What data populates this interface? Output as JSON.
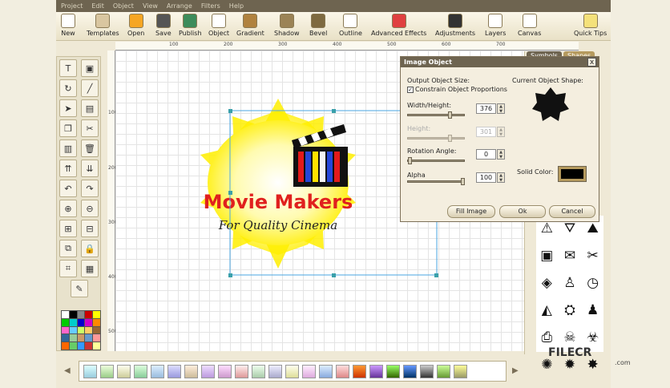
{
  "menu": [
    "Project",
    "Edit",
    "Object",
    "View",
    "Arrange",
    "Filters",
    "Help"
  ],
  "toolbar": [
    {
      "label": "New",
      "icon": "new-page-icon",
      "color": "#ffffff"
    },
    {
      "label": "Templates",
      "icon": "templates-icon",
      "color": "#d9c6a0"
    },
    {
      "label": "Open",
      "icon": "open-icon",
      "color": "#f6a623"
    },
    {
      "label": "Save",
      "icon": "save-icon",
      "color": "#555555"
    },
    {
      "label": "Publish",
      "icon": "globe-icon",
      "color": "#3d8c5b"
    },
    {
      "label": "Object",
      "icon": "object-icon",
      "color": "#ffffff"
    },
    {
      "label": "Gradient",
      "icon": "gradient-icon",
      "color": "#b0823f"
    },
    {
      "label": "Shadow",
      "icon": "shadow-icon",
      "color": "#9b8356"
    },
    {
      "label": "Bevel",
      "icon": "bevel-icon",
      "color": "#7e6a40"
    },
    {
      "label": "Outline",
      "icon": "outline-icon",
      "color": "#ffffff"
    },
    {
      "label": "Advanced Effects",
      "icon": "effects-icon",
      "color": "#e04040"
    },
    {
      "label": "Adjustments",
      "icon": "adjustments-icon",
      "color": "#333333"
    },
    {
      "label": "Layers",
      "icon": "layers-icon",
      "color": "#ffffff"
    },
    {
      "label": "Canvas",
      "icon": "canvas-icon",
      "color": "#ffffff"
    },
    {
      "label": "Quick Tips",
      "icon": "lightbulb-icon",
      "color": "#f4e17a"
    }
  ],
  "ruler": {
    "h_ticks": [
      "100",
      "200",
      "300",
      "400",
      "500",
      "600",
      "700"
    ],
    "v_ticks": [
      "100",
      "200",
      "300",
      "400",
      "500"
    ]
  },
  "logo": {
    "title": "Movie Makers",
    "tagline": "For Quality Cinema",
    "title_color": "#e0201e",
    "star_color": "#ffee00"
  },
  "side_tabs": [
    "Symbols",
    "Shapes"
  ],
  "dialog": {
    "title": "Image Object",
    "close": "x",
    "output_size_label": "Output Object Size:",
    "constrain_label": "Constrain Object Proportions",
    "constrain_checked": true,
    "width_label": "Width/Height:",
    "width_value": "376",
    "height_label": "Height:",
    "height_value": "301",
    "rotation_label": "Rotation Angle:",
    "rotation_value": "0",
    "alpha_label": "Alpha",
    "alpha_value": "100",
    "shape_label": "Current Object Shape:",
    "solid_color_label": "Solid Color:",
    "solid_color": "#000000",
    "buttons": {
      "fill": "Fill Image",
      "ok": "Ok",
      "cancel": "Cancel"
    }
  },
  "watermark": {
    "text": "FILECR",
    "sub": ".com"
  }
}
